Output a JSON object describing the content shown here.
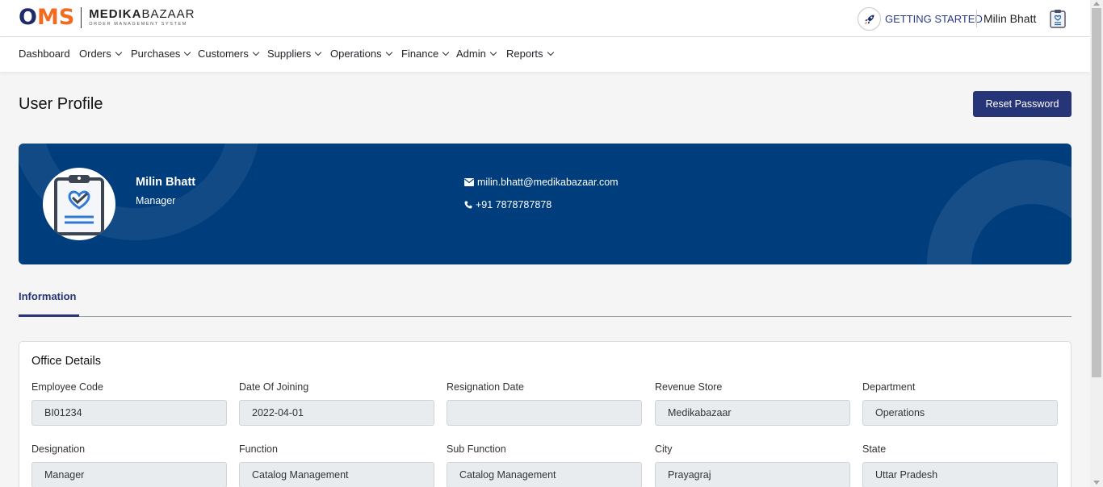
{
  "header": {
    "logo_o": "O",
    "logo_ms": "MS",
    "brand_bold": "MEDIKA",
    "brand_light": "BAZAAR",
    "brand_tagline": "ORDER MANAGEMENT SYSTEM",
    "getting_started": "GETTING STARTED",
    "user_name": "Milin Bhatt"
  },
  "nav": {
    "items": [
      {
        "label": "Dashboard",
        "dropdown": false
      },
      {
        "label": "Orders",
        "dropdown": true
      },
      {
        "label": "Purchases",
        "dropdown": true
      },
      {
        "label": "Customers",
        "dropdown": true
      },
      {
        "label": "Suppliers",
        "dropdown": true
      },
      {
        "label": "Operations",
        "dropdown": true
      },
      {
        "label": "Finance",
        "dropdown": true
      },
      {
        "label": "Admin",
        "dropdown": true
      },
      {
        "label": "Reports",
        "dropdown": true
      }
    ]
  },
  "page": {
    "title": "User Profile",
    "reset_password": "Reset Password"
  },
  "profile": {
    "name": "Milin Bhatt",
    "role": "Manager",
    "email": "milin.bhatt@medikabazaar.com",
    "phone": "+91 7878787878"
  },
  "tabs": {
    "information": "Information"
  },
  "office": {
    "title": "Office Details",
    "fields": [
      {
        "label": "Employee Code",
        "value": "BI01234"
      },
      {
        "label": "Date Of Joining",
        "value": "2022-04-01"
      },
      {
        "label": "Resignation Date",
        "value": ""
      },
      {
        "label": "Revenue Store",
        "value": "Medikabazaar"
      },
      {
        "label": "Department",
        "value": "Operations"
      },
      {
        "label": "Designation",
        "value": "Manager"
      },
      {
        "label": "Function",
        "value": "Catalog Management"
      },
      {
        "label": "Sub Function",
        "value": "Catalog Management"
      },
      {
        "label": "City",
        "value": "Prayagraj"
      },
      {
        "label": "State",
        "value": "Uttar Pradesh"
      }
    ]
  },
  "colors": {
    "primary": "#253577",
    "banner": "#003d7c",
    "accent": "#f26b21"
  }
}
